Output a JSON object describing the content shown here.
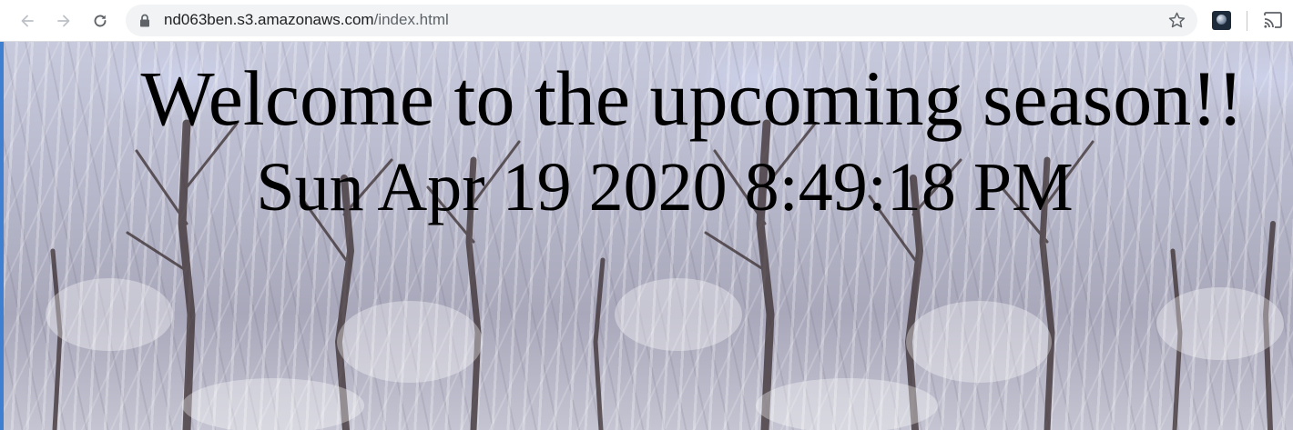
{
  "browser": {
    "url_host": "nd063ben.s3.amazonaws.com",
    "url_path": "/index.html",
    "icons": {
      "back": "arrow-left-icon",
      "forward": "arrow-right-icon",
      "reload": "reload-icon",
      "lock": "lock-icon",
      "bookmark": "star-icon",
      "extension": "extension-icon",
      "cast": "cast-icon"
    }
  },
  "page": {
    "heading": "Welcome to the upcoming season!!",
    "datetime": "Sun Apr 19 2020 8:49:18 PM",
    "text_color": "#000000",
    "background_theme": "snowy-forest"
  }
}
